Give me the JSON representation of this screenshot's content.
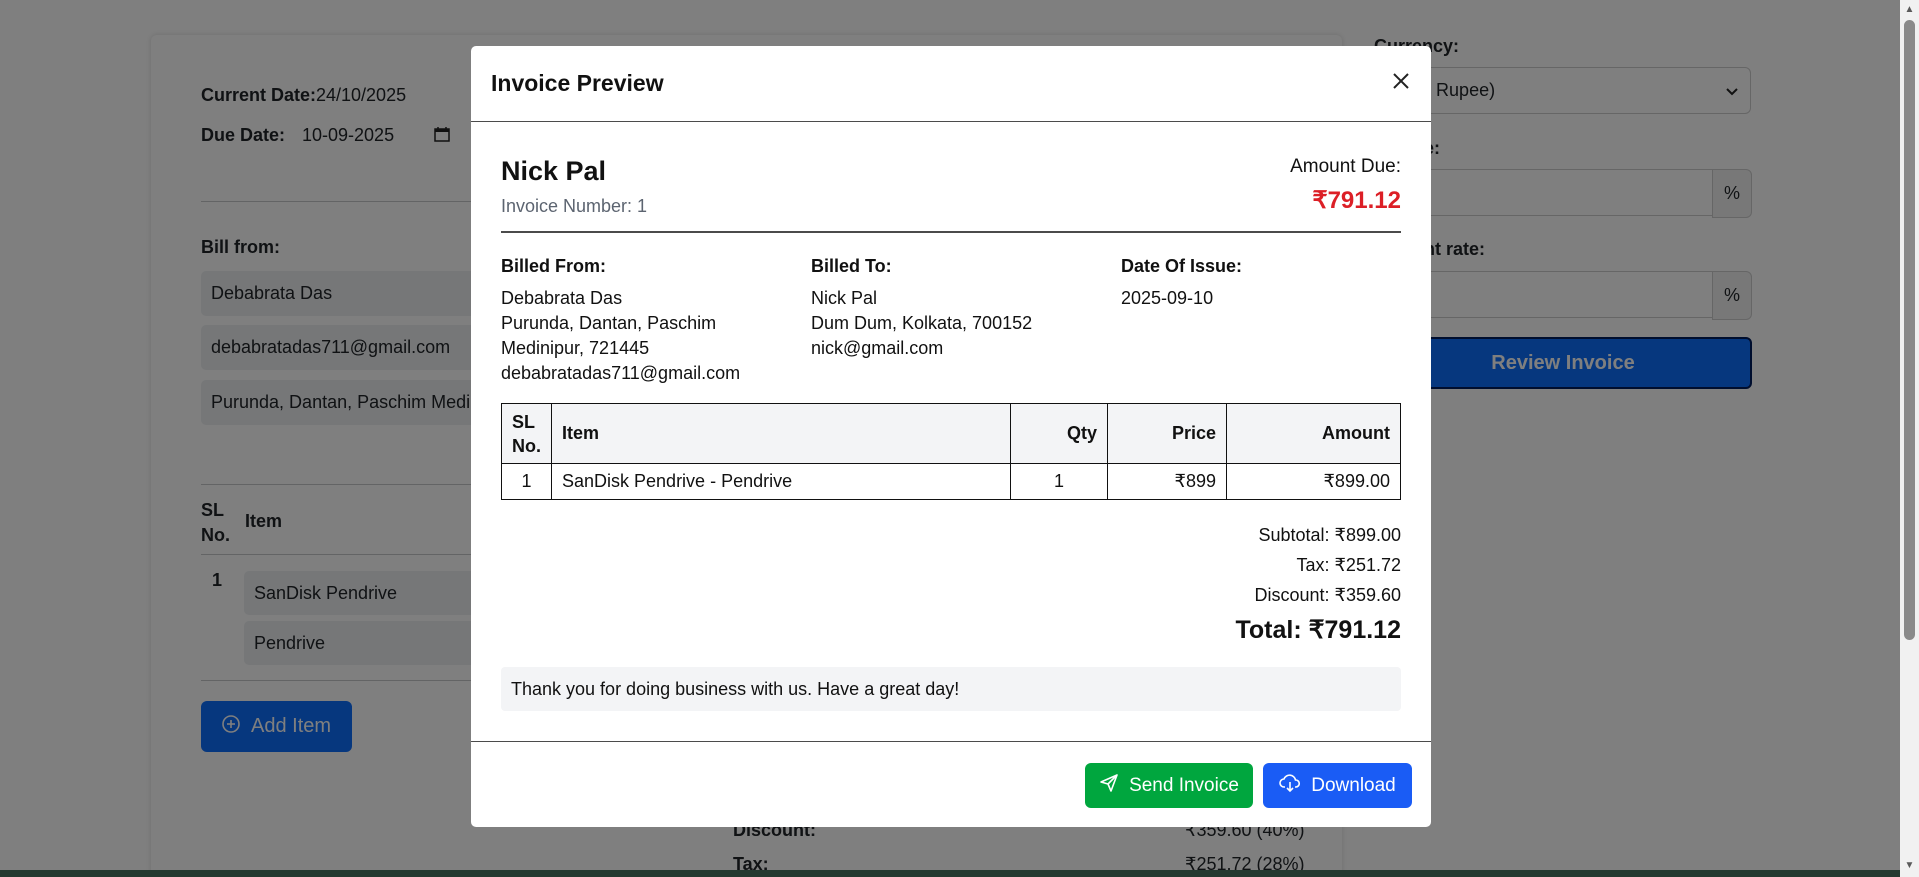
{
  "background": {
    "current_date_label": "Current Date:",
    "current_date_value": "24/10/2025",
    "due_date_label": "Due Date:",
    "due_date_value": "10-09-2025",
    "bill_from_label": "Bill from:",
    "bill_from_name": "Debabrata Das",
    "bill_from_email": "debabratadas711@gmail.com",
    "bill_from_address": "Purunda, Dantan, Paschim Medini",
    "table_sl_label": "SL No.",
    "table_item_label": "Item",
    "row_number": "1",
    "row_item_name": "SanDisk Pendrive",
    "row_item_desc": "Pendrive",
    "add_item_label": "Add Item",
    "discount_label": "Discount:",
    "discount_value": "₹359.60 (40%)",
    "tax_label": "Tax:",
    "tax_value": "₹251.72 (28%)",
    "currency_label": "Currency:",
    "currency_value": "ndian Rupee)",
    "tax_rate_label": "e:",
    "discount_rate_label": "nt rate:",
    "percent_symbol": "%",
    "review_label": "Review Invoice"
  },
  "modal": {
    "title": "Invoice Preview",
    "client_name": "Nick Pal",
    "invoice_number": "Invoice Number: 1",
    "amount_due_label": "Amount Due:",
    "amount_due_value": "₹791.12",
    "billed_from_label": "Billed From:",
    "billed_from_lines": [
      "Debabrata Das",
      "Purunda, Dantan, Paschim",
      "Medinipur, 721445",
      "debabratadas711@gmail.com"
    ],
    "billed_to_label": "Billed To:",
    "billed_to_lines": [
      "Nick Pal",
      "Dum Dum, Kolkata, 700152",
      "nick@gmail.com"
    ],
    "date_of_issue_label": "Date Of Issue:",
    "date_of_issue_value": "2025-09-10",
    "table_headers": {
      "sl_line1": "SL",
      "sl_line2": "No.",
      "item": "Item",
      "qty": "Qty",
      "price": "Price",
      "amount": "Amount"
    },
    "table_rows": [
      {
        "sl": "1",
        "item": "SanDisk Pendrive - Pendrive",
        "qty": "1",
        "price": "₹899",
        "amount": "₹899.00"
      }
    ],
    "subtotal": "Subtotal: ₹899.00",
    "tax": "Tax: ₹251.72",
    "discount": "Discount: ₹359.60",
    "total": "Total: ₹791.12",
    "note": "Thank you for doing business with us. Have a great day!",
    "send_label": "Send Invoice",
    "download_label": "Download"
  },
  "colors": {
    "primary": "#0d6efd",
    "success": "#00a63e",
    "amount_due": "#dc1f26"
  }
}
